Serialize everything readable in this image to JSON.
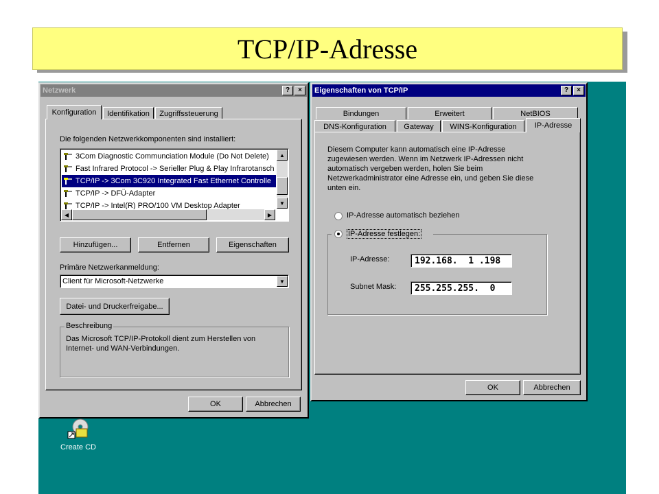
{
  "slide": {
    "title": "TCP/IP-Adresse"
  },
  "netzwerk": {
    "title": "Netzwerk",
    "help_btn": "?",
    "close_btn": "×",
    "tabs": [
      "Konfiguration",
      "Identifikation",
      "Zugriffssteuerung"
    ],
    "installed_label": "Die folgenden Netzwerkkomponenten sind installiert:",
    "components": [
      "3Com Diagnostic Communciation Module (Do Not Delete)",
      "Fast Infrared Protocol -> Serieller Plug & Play Infrarotansch",
      "TCP/IP -> 3Com 3C920 Integrated Fast Ethernet Controlle",
      "TCP/IP -> DFÜ-Adapter",
      "TCP/IP -> Intel(R) PRO/100 VM Desktop Adapter"
    ],
    "selected_index": 2,
    "buttons": {
      "add": "Hinzufügen...",
      "remove": "Entfernen",
      "properties": "Eigenschaften"
    },
    "primary_logon_label": "Primäre Netzwerkanmeldung:",
    "primary_logon_value": "Client für Microsoft-Netzwerke",
    "file_print_btn": "Datei- und Druckerfreigabe...",
    "description_label": "Beschreibung",
    "description_text": "Das Microsoft TCP/IP-Protokoll dient zum Herstellen von Internet- und WAN-Verbindungen.",
    "ok": "OK",
    "cancel": "Abbrechen"
  },
  "tcpip": {
    "title": "Eigenschaften von TCP/IP",
    "help_btn": "?",
    "close_btn": "×",
    "tabs_back": [
      "Bindungen",
      "Erweitert",
      "NetBIOS"
    ],
    "tabs_front": [
      "DNS-Konfiguration",
      "Gateway",
      "WINS-Konfiguration",
      "IP-Adresse"
    ],
    "info_text": "Diesem Computer kann automatisch eine IP-Adresse zugewiesen werden. Wenn im Netzwerk IP-Adressen nicht automatisch vergeben werden, holen Sie beim Netzwerkadministrator eine Adresse ein, und geben Sie diese unten ein.",
    "radio_auto": "IP-Adresse automatisch beziehen",
    "radio_fixed": "IP-Adresse festlegen:",
    "ip_label": "IP-Adresse:",
    "ip_value": "192.168.  1 .198",
    "mask_label": "Subnet Mask:",
    "mask_value": "255.255.255.  0",
    "ok": "OK",
    "cancel": "Abbrechen"
  },
  "desktop": {
    "icon_label": "Create CD"
  },
  "colors": {
    "desktop": "#008080",
    "face": "#c0c0c0",
    "active_title": "#000080",
    "banner": "#ffff80"
  }
}
